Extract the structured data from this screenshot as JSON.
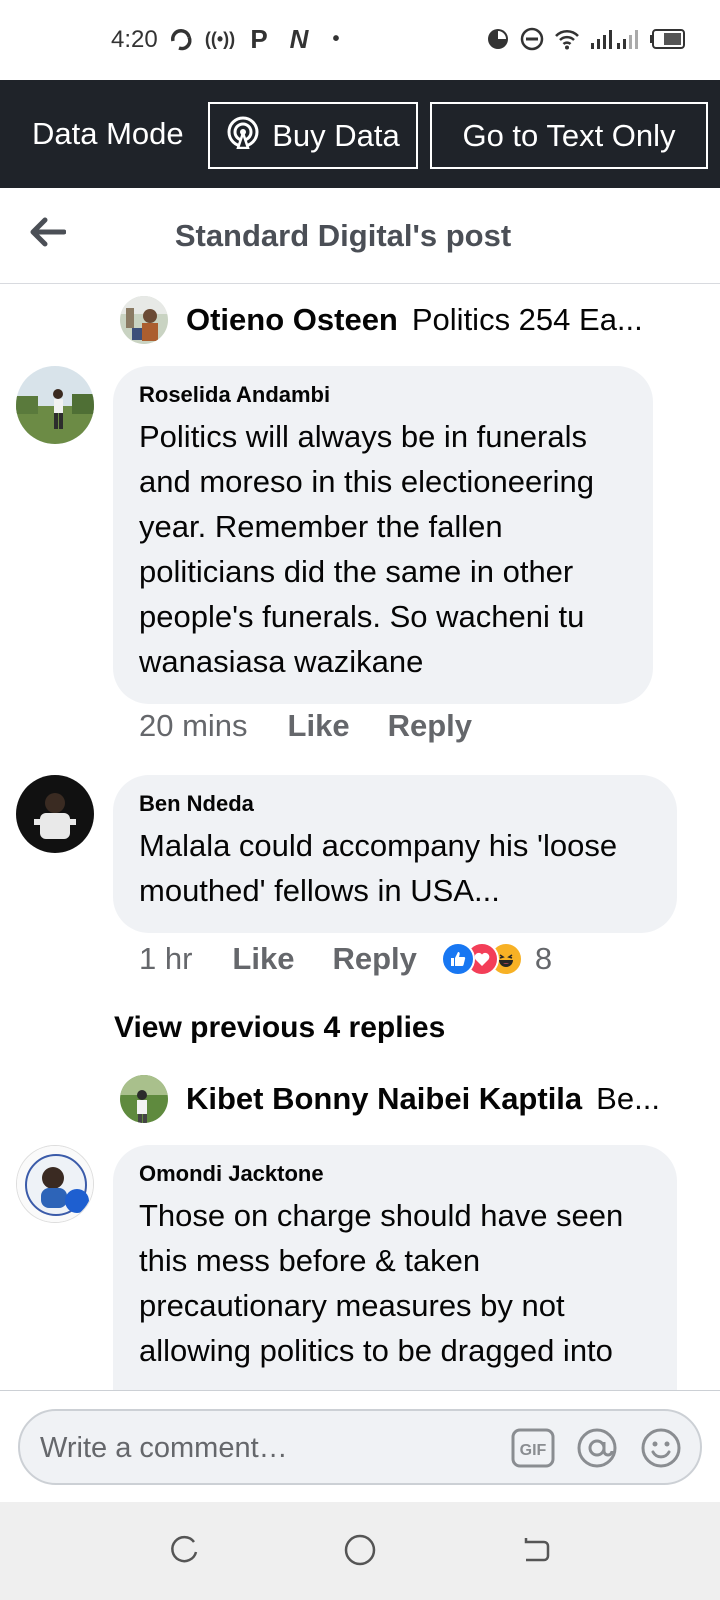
{
  "status_bar": {
    "time": "4:20",
    "left_icons": [
      "sync-icon",
      "hotspot-icon",
      "p-icon",
      "n-icon",
      "dot-icon"
    ],
    "right_icons": [
      "alarm-icon",
      "do-not-disturb-icon",
      "wifi-icon",
      "signal-icon",
      "signal-icon",
      "battery-icon"
    ]
  },
  "data_bar": {
    "mode_label": "Data Mode",
    "buy_data_label": "Buy Data",
    "text_only_label": "Go to Text Only"
  },
  "header": {
    "title": "Standard Digital's post"
  },
  "thread": [
    {
      "type": "reply_preview",
      "name": "Otieno Osteen",
      "snippet": "Politics 254 Ea..."
    },
    {
      "type": "comment",
      "author": "Roselida Andambi",
      "text": "Politics will always be in funerals and moreso in this electioneering year. Remember the fallen politicians did the same in other people's funerals. So wacheni tu wanasiasa wazikane",
      "time": "20 mins",
      "like_label": "Like",
      "reply_label": "Reply"
    },
    {
      "type": "comment",
      "author": "Ben Ndeda",
      "text": "Malala could accompany his 'loose mouthed' fellows in USA...",
      "time": "1 hr",
      "like_label": "Like",
      "reply_label": "Reply",
      "reaction_count": "8",
      "reactions": [
        "like-reaction-icon",
        "love-reaction-icon",
        "haha-reaction-icon"
      ]
    },
    {
      "type": "view_previous",
      "label": "View previous 4 replies"
    },
    {
      "type": "reply_preview",
      "name": "Kibet Bonny Naibei Kaptila",
      "snippet": "Be..."
    },
    {
      "type": "comment",
      "author": "Omondi Jacktone",
      "text": "Those on charge should have seen this mess before & taken precautionary measures by not allowing politics to be dragged into"
    }
  ],
  "composer": {
    "placeholder": "Write a comment…",
    "gif_label": "GIF"
  },
  "colors": {
    "data_bar_bg": "#1f2329",
    "bubble_bg": "#f0f2f5",
    "secondary_text": "#65676b",
    "like_blue": "#1877f2",
    "love_red": "#f33e58",
    "haha_yellow": "#f7b125"
  }
}
